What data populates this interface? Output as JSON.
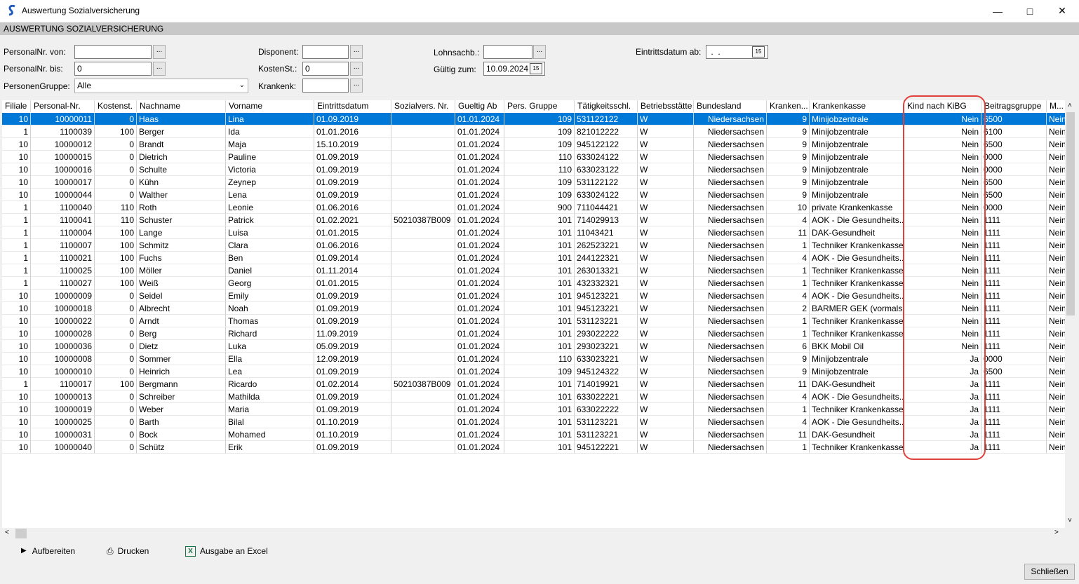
{
  "window": {
    "title": "Auswertung Sozialversicherung",
    "minimize_icon": "minimize-icon",
    "maximize_icon": "maximize-icon",
    "close_icon": "close-icon"
  },
  "section": {
    "title": "AUSWERTUNG SOZIALVERSICHERUNG"
  },
  "filters": {
    "personalnr_von": {
      "label": "PersonalNr. von:",
      "value": ""
    },
    "personalnr_bis": {
      "label": "PersonalNr. bis:",
      "value": "0"
    },
    "personengruppe": {
      "label": "PersonenGruppe:",
      "value": "Alle"
    },
    "disponent": {
      "label": "Disponent:",
      "value": ""
    },
    "kostenst": {
      "label": "KostenSt.:",
      "value": "0"
    },
    "krankenk": {
      "label": "Krankenk:",
      "value": ""
    },
    "lohnsachb": {
      "label": "Lohnsachb.:",
      "value": ""
    },
    "gueltig_zum": {
      "label": "Gültig zum:",
      "value": "10.09.2024"
    },
    "eintrittsdatum_ab": {
      "label": "Eintrittsdatum ab:",
      "value": " .  ."
    },
    "ellipsis": "..."
  },
  "grid": {
    "columns": [
      "Filiale",
      "Personal-Nr.",
      "Kostenst.",
      "Nachname",
      "Vorname",
      "Eintrittsdatum",
      "Sozialvers. Nr.",
      "Gueltig Ab",
      "Pers. Gruppe",
      "Tätigkeitsschl.",
      "Betriebsstätte",
      "Bundesland",
      "Kranken...",
      "Krankenkasse",
      "Kind nach KiBG",
      "Beitragsgruppe",
      "M..."
    ],
    "rows": [
      [
        "10",
        "10000011",
        "0",
        "Haas",
        "Lina",
        "01.09.2019",
        "",
        "01.01.2024",
        "109",
        "531122122",
        "W",
        "Niedersachsen",
        "9",
        "Minijobzentrale",
        "Nein",
        "6500",
        "Nein"
      ],
      [
        "1",
        "1100039",
        "100",
        "Berger",
        "Ida",
        "01.01.2016",
        "",
        "01.01.2024",
        "109",
        "821012222",
        "W",
        "Niedersachsen",
        "9",
        "Minijobzentrale",
        "Nein",
        "6100",
        "Nein"
      ],
      [
        "10",
        "10000012",
        "0",
        "Brandt",
        "Maja",
        "15.10.2019",
        "",
        "01.01.2024",
        "109",
        "945122122",
        "W",
        "Niedersachsen",
        "9",
        "Minijobzentrale",
        "Nein",
        "6500",
        "Nein"
      ],
      [
        "10",
        "10000015",
        "0",
        "Dietrich",
        "Pauline",
        "01.09.2019",
        "",
        "01.01.2024",
        "110",
        "633024122",
        "W",
        "Niedersachsen",
        "9",
        "Minijobzentrale",
        "Nein",
        "0000",
        "Nein"
      ],
      [
        "10",
        "10000016",
        "0",
        "Schulte",
        "Victoria",
        "01.09.2019",
        "",
        "01.01.2024",
        "110",
        "633023122",
        "W",
        "Niedersachsen",
        "9",
        "Minijobzentrale",
        "Nein",
        "0000",
        "Nein"
      ],
      [
        "10",
        "10000017",
        "0",
        "Kühn",
        "Zeynep",
        "01.09.2019",
        "",
        "01.01.2024",
        "109",
        "531122122",
        "W",
        "Niedersachsen",
        "9",
        "Minijobzentrale",
        "Nein",
        "6500",
        "Nein"
      ],
      [
        "10",
        "10000044",
        "0",
        "Walther",
        "Lena",
        "01.09.2019",
        "",
        "01.01.2024",
        "109",
        "633024122",
        "W",
        "Niedersachsen",
        "9",
        "Minijobzentrale",
        "Nein",
        "6500",
        "Nein"
      ],
      [
        "1",
        "1100040",
        "110",
        "Roth",
        "Leonie",
        "01.06.2016",
        "",
        "01.01.2024",
        "900",
        "711044421",
        "W",
        "Niedersachsen",
        "10",
        "private Krankenkasse",
        "Nein",
        "0000",
        "Nein"
      ],
      [
        "1",
        "1100041",
        "110",
        "Schuster",
        "Patrick",
        "01.02.2021",
        "50210387B009",
        "01.01.2024",
        "101",
        "714029913",
        "W",
        "Niedersachsen",
        "4",
        "AOK - Die Gesundheits...",
        "Nein",
        "1111",
        "Nein"
      ],
      [
        "1",
        "1100004",
        "100",
        "Lange",
        "Luisa",
        "01.01.2015",
        "",
        "01.01.2024",
        "101",
        "11043421",
        "W",
        "Niedersachsen",
        "11",
        "DAK-Gesundheit",
        "Nein",
        "1111",
        "Nein"
      ],
      [
        "1",
        "1100007",
        "100",
        "Schmitz",
        "Clara",
        "01.06.2016",
        "",
        "01.01.2024",
        "101",
        "262523221",
        "W",
        "Niedersachsen",
        "1",
        "Techniker Krankenkasse",
        "Nein",
        "1111",
        "Nein"
      ],
      [
        "1",
        "1100021",
        "100",
        "Fuchs",
        "Ben",
        "01.09.2014",
        "",
        "01.01.2024",
        "101",
        "244122321",
        "W",
        "Niedersachsen",
        "4",
        "AOK - Die Gesundheits...",
        "Nein",
        "1111",
        "Nein"
      ],
      [
        "1",
        "1100025",
        "100",
        "Möller",
        "Daniel",
        "01.11.2014",
        "",
        "01.01.2024",
        "101",
        "263013321",
        "W",
        "Niedersachsen",
        "1",
        "Techniker Krankenkasse",
        "Nein",
        "1111",
        "Nein"
      ],
      [
        "1",
        "1100027",
        "100",
        "Weiß",
        "Georg",
        "01.01.2015",
        "",
        "01.01.2024",
        "101",
        "432332321",
        "W",
        "Niedersachsen",
        "1",
        "Techniker Krankenkasse",
        "Nein",
        "1111",
        "Nein"
      ],
      [
        "10",
        "10000009",
        "0",
        "Seidel",
        "Emily",
        "01.09.2019",
        "",
        "01.01.2024",
        "101",
        "945123221",
        "W",
        "Niedersachsen",
        "4",
        "AOK - Die Gesundheits...",
        "Nein",
        "1111",
        "Nein"
      ],
      [
        "10",
        "10000018",
        "0",
        "Albrecht",
        "Noah",
        "01.09.2019",
        "",
        "01.01.2024",
        "101",
        "945123221",
        "W",
        "Niedersachsen",
        "2",
        "BARMER GEK (vormals ...",
        "Nein",
        "1111",
        "Nein"
      ],
      [
        "10",
        "10000022",
        "0",
        "Arndt",
        "Thomas",
        "01.09.2019",
        "",
        "01.01.2024",
        "101",
        "531123221",
        "W",
        "Niedersachsen",
        "1",
        "Techniker Krankenkasse",
        "Nein",
        "1111",
        "Nein"
      ],
      [
        "10",
        "10000028",
        "0",
        "Berg",
        "Richard",
        "11.09.2019",
        "",
        "01.01.2024",
        "101",
        "293022222",
        "W",
        "Niedersachsen",
        "1",
        "Techniker Krankenkasse",
        "Nein",
        "1111",
        "Nein"
      ],
      [
        "10",
        "10000036",
        "0",
        "Dietz",
        "Luka",
        "05.09.2019",
        "",
        "01.01.2024",
        "101",
        "293023221",
        "W",
        "Niedersachsen",
        "6",
        "BKK Mobil Oil",
        "Nein",
        "1111",
        "Nein"
      ],
      [
        "10",
        "10000008",
        "0",
        "Sommer",
        "Ella",
        "12.09.2019",
        "",
        "01.01.2024",
        "110",
        "633023221",
        "W",
        "Niedersachsen",
        "9",
        "Minijobzentrale",
        "Ja",
        "0000",
        "Nein"
      ],
      [
        "10",
        "10000010",
        "0",
        "Heinrich",
        "Lea",
        "01.09.2019",
        "",
        "01.01.2024",
        "109",
        "945124322",
        "W",
        "Niedersachsen",
        "9",
        "Minijobzentrale",
        "Ja",
        "6500",
        "Nein"
      ],
      [
        "1",
        "1100017",
        "100",
        "Bergmann",
        "Ricardo",
        "01.02.2014",
        "50210387B009",
        "01.01.2024",
        "101",
        "714019921",
        "W",
        "Niedersachsen",
        "11",
        "DAK-Gesundheit",
        "Ja",
        "1111",
        "Nein"
      ],
      [
        "10",
        "10000013",
        "0",
        "Schreiber",
        "Mathilda",
        "01.09.2019",
        "",
        "01.01.2024",
        "101",
        "633022221",
        "W",
        "Niedersachsen",
        "4",
        "AOK - Die Gesundheits...",
        "Ja",
        "1111",
        "Nein"
      ],
      [
        "10",
        "10000019",
        "0",
        "Weber",
        "Maria",
        "01.09.2019",
        "",
        "01.01.2024",
        "101",
        "633022222",
        "W",
        "Niedersachsen",
        "1",
        "Techniker Krankenkasse",
        "Ja",
        "1111",
        "Nein"
      ],
      [
        "10",
        "10000025",
        "0",
        "Barth",
        "Bilal",
        "01.10.2019",
        "",
        "01.01.2024",
        "101",
        "531123221",
        "W",
        "Niedersachsen",
        "4",
        "AOK - Die Gesundheits...",
        "Ja",
        "1111",
        "Nein"
      ],
      [
        "10",
        "10000031",
        "0",
        "Bock",
        "Mohamed",
        "01.10.2019",
        "",
        "01.01.2024",
        "101",
        "531123221",
        "W",
        "Niedersachsen",
        "11",
        "DAK-Gesundheit",
        "Ja",
        "1111",
        "Nein"
      ],
      [
        "10",
        "10000040",
        "0",
        "Schütz",
        "Erik",
        "01.09.2019",
        "",
        "01.01.2024",
        "101",
        "945122221",
        "W",
        "Niedersachsen",
        "1",
        "Techniker Krankenkasse",
        "Ja",
        "1111",
        "Nein"
      ]
    ]
  },
  "toolbar": {
    "aufbereiten": "Aufbereiten",
    "drucken": "Drucken",
    "excel": "Ausgabe an Excel"
  },
  "close_button": "Schließen",
  "colors": {
    "selection": "#0078d7",
    "highlight": "#e0413c",
    "header_bar": "#c8c8c8"
  }
}
